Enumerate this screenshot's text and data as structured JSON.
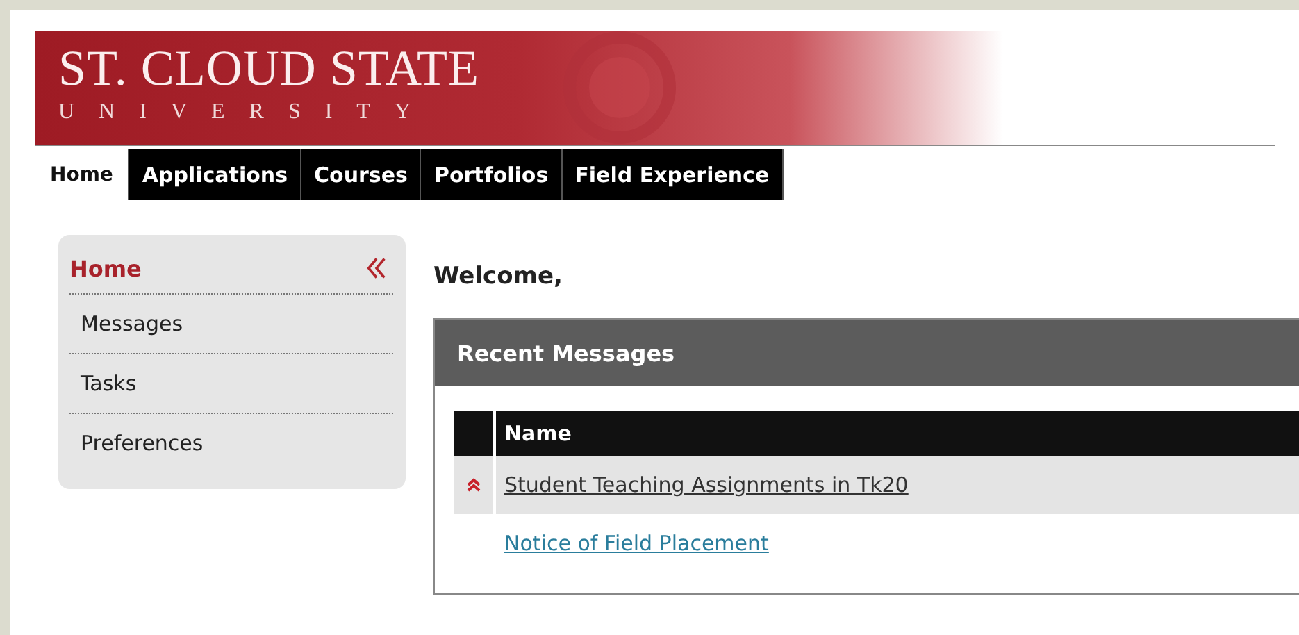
{
  "banner": {
    "title": "ST. CLOUD STATE",
    "subtitle": "UNIVERSITY"
  },
  "tabs": [
    {
      "label": "Home",
      "selected": true
    },
    {
      "label": "Applications",
      "selected": false
    },
    {
      "label": "Courses",
      "selected": false
    },
    {
      "label": "Portfolios",
      "selected": false
    },
    {
      "label": "Field Experience",
      "selected": false
    }
  ],
  "sidebar": {
    "items": [
      {
        "label": "Home",
        "selected": true
      },
      {
        "label": "Messages",
        "selected": false
      },
      {
        "label": "Tasks",
        "selected": false
      },
      {
        "label": "Preferences",
        "selected": false
      }
    ]
  },
  "welcome": "Welcome,",
  "recent_messages": {
    "title": "Recent Messages",
    "columns": [
      "Name"
    ],
    "rows": [
      {
        "name": "Student Teaching Assignments in Tk20",
        "high_priority": true,
        "selected": true
      },
      {
        "name": "Notice of Field Placement",
        "high_priority": false,
        "selected": false
      }
    ]
  }
}
